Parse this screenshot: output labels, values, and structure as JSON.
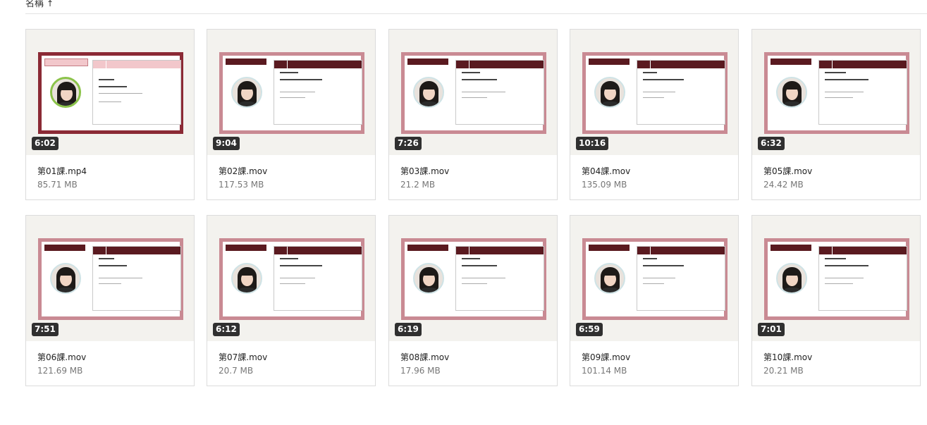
{
  "sort_header": {
    "label": "名稱",
    "arrow": "↑"
  },
  "videos": [
    {
      "name": "第01課.mp4",
      "size": "85.71 MB",
      "duration": "6:02"
    },
    {
      "name": "第02課.mov",
      "size": "117.53 MB",
      "duration": "9:04"
    },
    {
      "name": "第03課.mov",
      "size": "21.2 MB",
      "duration": "7:26"
    },
    {
      "name": "第04課.mov",
      "size": "135.09 MB",
      "duration": "10:16"
    },
    {
      "name": "第05課.mov",
      "size": "24.42 MB",
      "duration": "6:32"
    },
    {
      "name": "第06課.mov",
      "size": "121.69 MB",
      "duration": "7:51"
    },
    {
      "name": "第07課.mov",
      "size": "20.7 MB",
      "duration": "6:12"
    },
    {
      "name": "第08課.mov",
      "size": "17.96 MB",
      "duration": "6:19"
    },
    {
      "name": "第09課.mov",
      "size": "101.14 MB",
      "duration": "6:59"
    },
    {
      "name": "第10課.mov",
      "size": "20.21 MB",
      "duration": "7:01"
    }
  ],
  "colors": {
    "slide_border": "#c98a93",
    "slide_border_dark": "#8b2a35",
    "slide_header": "#5a1a20",
    "badge": "#303030"
  }
}
